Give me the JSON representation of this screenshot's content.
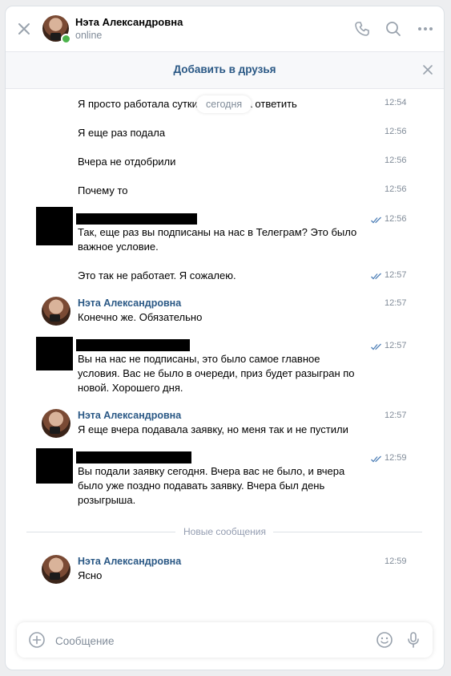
{
  "header": {
    "contact_name": "Нэта Александровна",
    "status": "online"
  },
  "add_friend": {
    "label": "Добавить в друзья"
  },
  "date_separator": "сегодня",
  "messages": [
    {
      "text": "Я просто работала сутки и не могла ответить",
      "time": "12:54"
    },
    {
      "text": "Я еще раз подала",
      "time": "12:56"
    },
    {
      "text": "Вчера не отдобрили",
      "time": "12:56"
    },
    {
      "text": "Почему то",
      "time": "12:56"
    },
    {
      "lines": [
        "Так, еще раз вы подписаны на нас в Телеграм? Это было",
        "важное условие."
      ],
      "time": "12:56",
      "read": true
    },
    {
      "text": "Это так не работает. Я сожалею.",
      "time": "12:57",
      "read": true
    },
    {
      "author": "Нэта Александровна",
      "text": "Конечно же. Обязательно",
      "time": "12:57"
    },
    {
      "lines": [
        "Вы на нас не подписаны, это было самое главное",
        "условия. Вас не было в очереди, приз будет разыгран по",
        "новой. Хорошего дня."
      ],
      "time": "12:57",
      "read": true
    },
    {
      "author": "Нэта Александровна",
      "text": "Я еще вчера подавала заявку, но меня так и не пустили",
      "time": "12:57"
    },
    {
      "lines": [
        "Вы подали заявку сегодня. Вчера вас не было, и вчера",
        "было уже поздно подавать заявку. Вчера был день",
        "розыгрыша."
      ],
      "time": "12:59",
      "read": true
    },
    {
      "author": "Нэта Александровна",
      "text": "Ясно",
      "time": "12:59"
    }
  ],
  "new_messages_label": "Новые сообщения",
  "composer": {
    "placeholder": "Сообщение",
    "value": ""
  },
  "colors": {
    "accent": "#2a5885",
    "online": "#4bb34b",
    "meta": "#818c99",
    "read_ticks": "#5181b8"
  },
  "icons": [
    "close-icon",
    "phone-icon",
    "search-icon",
    "more-icon",
    "add-icon",
    "emoji-icon",
    "microphone-icon",
    "read-ticks-icon"
  ]
}
